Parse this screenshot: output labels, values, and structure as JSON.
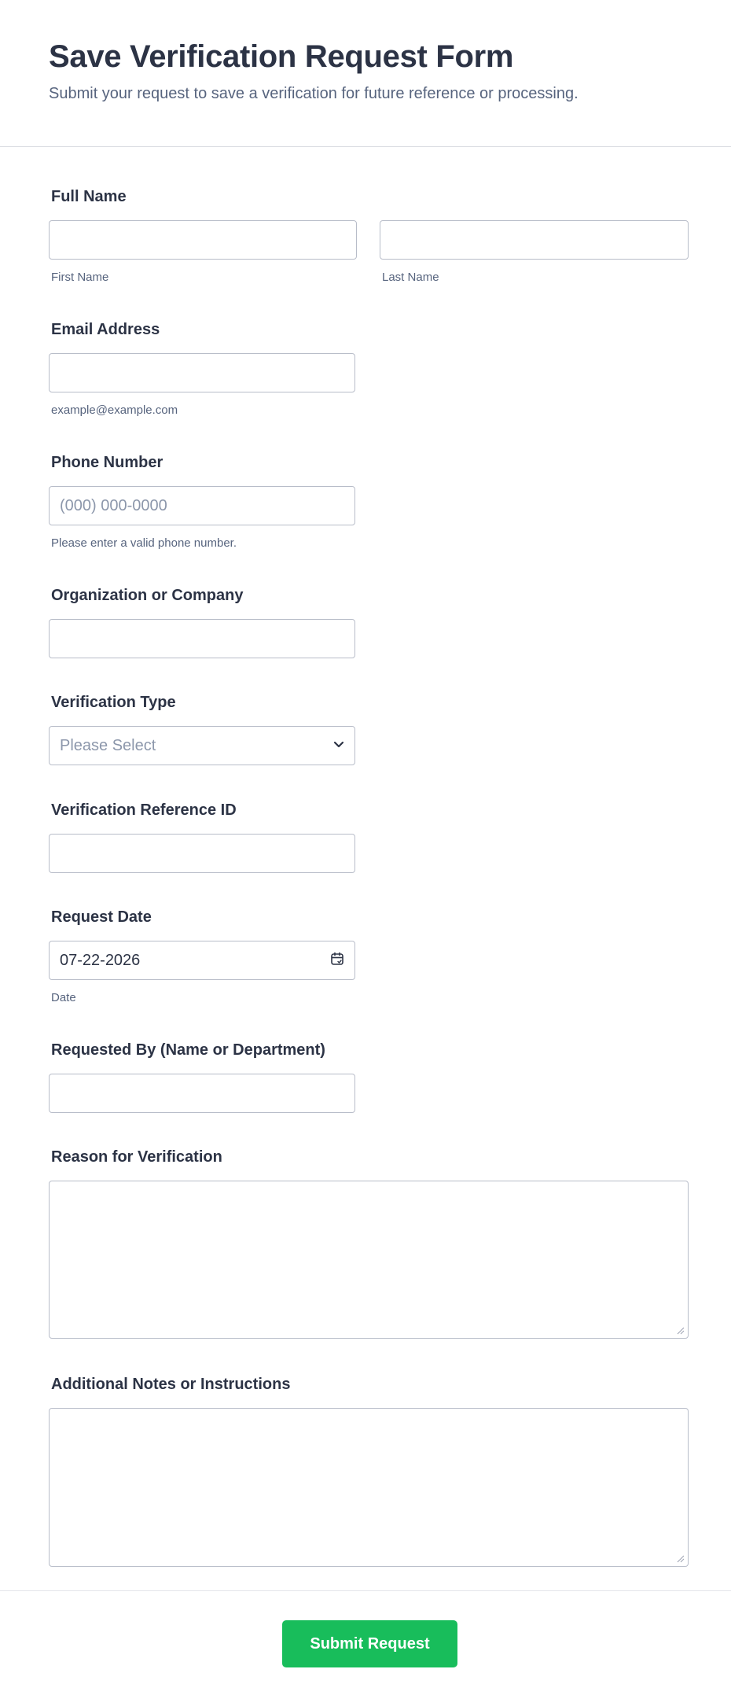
{
  "header": {
    "title": "Save Verification Request Form",
    "subtitle": "Submit your request to save a verification for future reference or processing."
  },
  "fields": {
    "full_name": {
      "label": "Full Name",
      "first_sublabel": "First Name",
      "last_sublabel": "Last Name",
      "first_value": "",
      "last_value": ""
    },
    "email": {
      "label": "Email Address",
      "sublabel": "example@example.com",
      "value": ""
    },
    "phone": {
      "label": "Phone Number",
      "placeholder": "(000) 000-0000",
      "sublabel": "Please enter a valid phone number.",
      "value": ""
    },
    "organization": {
      "label": "Organization or Company",
      "value": ""
    },
    "verification_type": {
      "label": "Verification Type",
      "selected": "Please Select",
      "icon": "chevron-down-icon"
    },
    "reference_id": {
      "label": "Verification Reference ID",
      "value": ""
    },
    "request_date": {
      "label": "Request Date",
      "value": "07-22-2026",
      "sublabel": "Date",
      "icon": "calendar-icon"
    },
    "requested_by": {
      "label": "Requested By (Name or Department)",
      "value": ""
    },
    "reason": {
      "label": "Reason for Verification",
      "value": ""
    },
    "notes": {
      "label": "Additional Notes or Instructions",
      "value": ""
    }
  },
  "submit": {
    "label": "Submit Request",
    "color": "#18bd5b"
  }
}
